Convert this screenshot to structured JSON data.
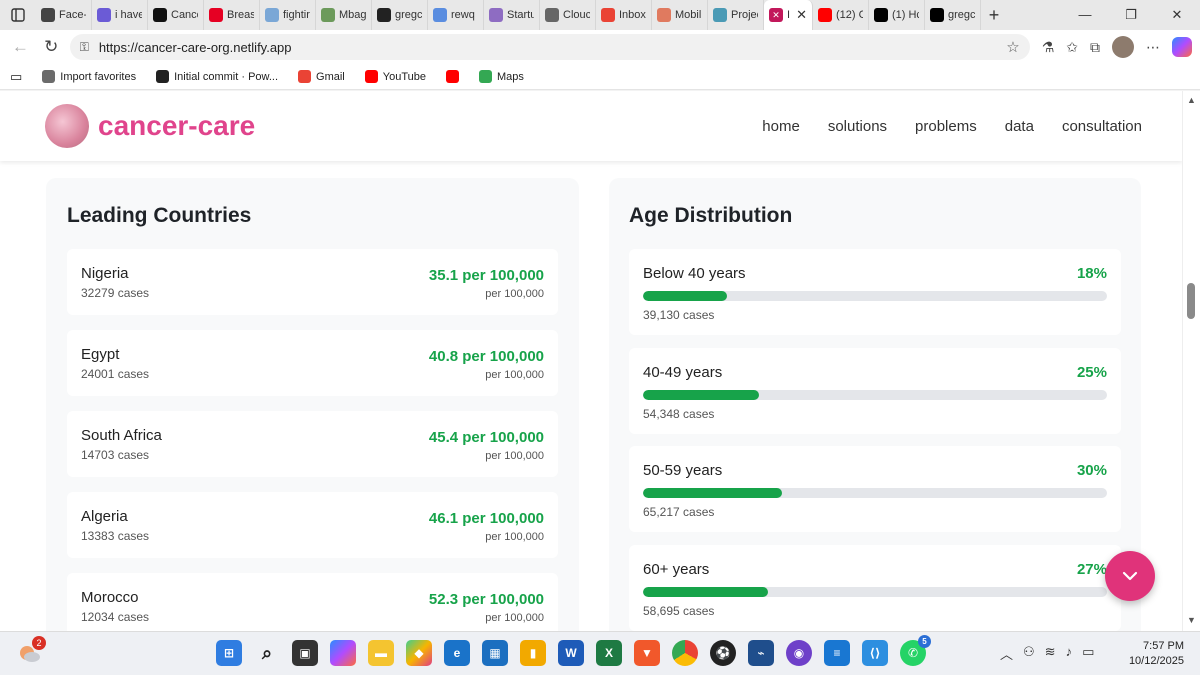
{
  "browser": {
    "tabs": [
      {
        "label": "Face-",
        "color": "#444"
      },
      {
        "label": "i have",
        "color": "#6b5bd6"
      },
      {
        "label": "Cance",
        "color": "#111"
      },
      {
        "label": "Breas",
        "color": "#e60023"
      },
      {
        "label": "fightir",
        "color": "#7aa7d6"
      },
      {
        "label": "Mbag",
        "color": "#6c9a5b"
      },
      {
        "label": "gregc",
        "color": "#222"
      },
      {
        "label": "rewq",
        "color": "#5a8de0"
      },
      {
        "label": "Startu",
        "color": "#8e6cc2"
      },
      {
        "label": "Clouc",
        "color": "#666"
      },
      {
        "label": "Inbox",
        "color": "#ea4335"
      },
      {
        "label": "Mobil",
        "color": "#e07a5f"
      },
      {
        "label": "Projec",
        "color": "#4a9ab5"
      }
    ],
    "active_tab": {
      "label": "I"
    },
    "tabs_after": [
      {
        "label": "(12) C",
        "color": "#ff0000"
      },
      {
        "label": "(1) Hc",
        "color": "#000"
      },
      {
        "label": "gregc",
        "color": "#000"
      }
    ],
    "url": "https://cancer-care-org.netlify.app",
    "favorites": [
      {
        "label": "Import favorites",
        "color": "#6b6b6b"
      },
      {
        "label": "Initial commit · Pow...",
        "color": "#222"
      },
      {
        "label": "Gmail",
        "color": "#ea4335"
      },
      {
        "label": "YouTube",
        "color": "#ff0000"
      },
      {
        "label": "",
        "color": "#ff0000"
      },
      {
        "label": "Maps",
        "color": "#34a853"
      }
    ]
  },
  "site": {
    "brand": "cancer-care",
    "nav": [
      "home",
      "solutions",
      "problems",
      "data",
      "consultation"
    ]
  },
  "countries": {
    "title": "Leading Countries",
    "rows": [
      {
        "name": "Nigeria",
        "cases": "32279 cases",
        "rate": "35.1 per 100,000",
        "unit": "per 100,000"
      },
      {
        "name": "Egypt",
        "cases": "24001 cases",
        "rate": "40.8 per 100,000",
        "unit": "per 100,000"
      },
      {
        "name": "South Africa",
        "cases": "14703 cases",
        "rate": "45.4 per 100,000",
        "unit": "per 100,000"
      },
      {
        "name": "Algeria",
        "cases": "13383 cases",
        "rate": "46.1 per 100,000",
        "unit": "per 100,000"
      },
      {
        "name": "Morocco",
        "cases": "12034 cases",
        "rate": "52.3 per 100,000",
        "unit": "per 100,000"
      }
    ]
  },
  "age": {
    "title": "Age Distribution",
    "groups": [
      {
        "label": "Below 40 years",
        "pct": "18%",
        "value": 0.18,
        "count": "39,130 cases"
      },
      {
        "label": "40-49 years",
        "pct": "25%",
        "value": 0.25,
        "count": "54,348 cases"
      },
      {
        "label": "50-59 years",
        "pct": "30%",
        "value": 0.3,
        "count": "65,217 cases"
      },
      {
        "label": "60+ years",
        "pct": "27%",
        "value": 0.27,
        "count": "58,695 cases"
      }
    ]
  },
  "colors": {
    "brand": "#e0448c",
    "accent_green": "#17a34a",
    "fab": "#e0337a"
  },
  "taskbar": {
    "notification_badge": "2",
    "whatsapp_badge": "5",
    "time": "7:57 PM",
    "date": "10/12/2025"
  }
}
